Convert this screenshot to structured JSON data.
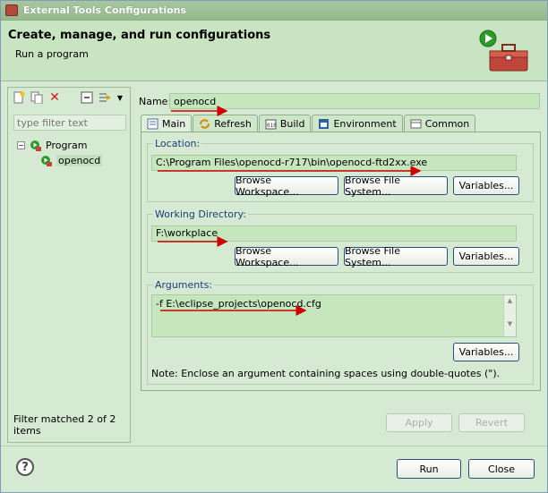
{
  "window": {
    "title": "External Tools Configurations"
  },
  "header": {
    "title": "Create, manage, and run configurations",
    "subtitle": "Run a program"
  },
  "sidebar": {
    "filter_placeholder": "type filter text",
    "tree": [
      {
        "label": "Program",
        "expanded": true
      },
      {
        "label": "openocd",
        "selected": true
      }
    ],
    "status": "Filter matched 2 of 2 items"
  },
  "config": {
    "name_label": "Name:",
    "name_value": "openocd",
    "tabs": [
      {
        "label": "Main",
        "active": true
      },
      {
        "label": "Refresh"
      },
      {
        "label": "Build"
      },
      {
        "label": "Environment"
      },
      {
        "label": "Common"
      }
    ],
    "location": {
      "label": "Location:",
      "value": "C:\\Program Files\\openocd-r717\\bin\\openocd-ftd2xx.exe",
      "buttons": [
        "Browse Workspace...",
        "Browse File System...",
        "Variables..."
      ]
    },
    "working_dir": {
      "label": "Working Directory:",
      "value": "F:\\workplace",
      "buttons": [
        "Browse Workspace...",
        "Browse File System...",
        "Variables..."
      ]
    },
    "arguments": {
      "label": "Arguments:",
      "value": "-f E:\\eclipse_projects\\openocd.cfg",
      "variables_button": "Variables...",
      "note": "Note: Enclose an argument containing spaces using double-quotes (\")."
    },
    "apply_label": "Apply",
    "revert_label": "Revert"
  },
  "footer": {
    "run_label": "Run",
    "close_label": "Close"
  },
  "colors": {
    "background": "#d6e9d3",
    "field": "#c6e6be",
    "annotation_arrow": "#cc0000"
  }
}
